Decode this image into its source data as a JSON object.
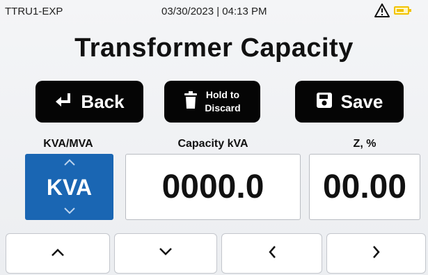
{
  "status": {
    "device": "TTRU1-EXP",
    "datetime": "03/30/2023 | 04:13 PM",
    "warning_icon": "warning-triangle-icon",
    "battery_icon": "battery-icon",
    "battery_color": "#f2c200"
  },
  "page": {
    "title": "Transformer Capacity"
  },
  "actions": {
    "back_label": "Back",
    "hold_label_1": "Hold to",
    "hold_label_2": "Discard",
    "save_label": "Save"
  },
  "fields": {
    "unit": {
      "header": "KVA/MVA",
      "value": "KVA"
    },
    "capacity": {
      "header": "Capacity kVA",
      "value": "0000.0"
    },
    "impedance": {
      "header": "Z, %",
      "value": "00.00"
    }
  },
  "nav": [
    {
      "icon": "chevron-up-icon"
    },
    {
      "icon": "chevron-down-icon"
    },
    {
      "icon": "chevron-left-icon"
    },
    {
      "icon": "chevron-right-icon"
    }
  ],
  "colors": {
    "accent": "#1a66b3",
    "button_bg": "#050505"
  }
}
